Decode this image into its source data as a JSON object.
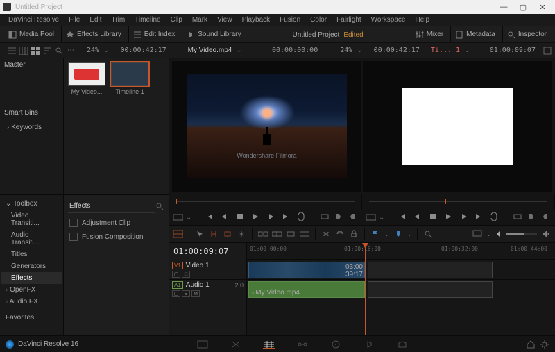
{
  "window": {
    "title": "Untitled Project"
  },
  "menu": [
    "DaVinci Resolve",
    "File",
    "Edit",
    "Trim",
    "Timeline",
    "Clip",
    "Mark",
    "View",
    "Playback",
    "Fusion",
    "Color",
    "Fairlight",
    "Workspace",
    "Help"
  ],
  "toolbar": {
    "mediaPool": "Media Pool",
    "fxLib": "Effects Library",
    "editIndex": "Edit Index",
    "soundLib": "Sound Library",
    "mixer": "Mixer",
    "metadata": "Metadata",
    "inspector": "Inspector",
    "projectTitle": "Untitled Project",
    "edited": "Edited"
  },
  "viewerbar": {
    "left": {
      "zoom": "24%",
      "tc": "00:00:42:17"
    },
    "clip": "My Video.mp4",
    "srcTc": "00:00:00:00",
    "right": {
      "zoom": "24%",
      "tc": "00:00:42:17",
      "tlname": "Ti... 1",
      "recTc": "01:00:09:07"
    }
  },
  "bins": {
    "master": "Master",
    "smartBins": "Smart Bins",
    "keywords": "Keywords"
  },
  "pool": {
    "items": [
      {
        "label": "My Video..."
      },
      {
        "label": "Timeline 1"
      }
    ]
  },
  "sidebar": {
    "toolbox": "Toolbox",
    "items": [
      "Video Transiti...",
      "Audio Transiti...",
      "Titles",
      "Generators",
      "Effects"
    ],
    "openfx": "OpenFX",
    "audiofx": "Audio FX",
    "favorites": "Favorites"
  },
  "fx": {
    "header": "Effects",
    "items": [
      "Adjustment Clip",
      "Fusion Composition"
    ]
  },
  "watermark": "Wondershare Filmora",
  "timeline": {
    "tc": "01:00:09:07",
    "ruler": [
      "01:00:00:00",
      "01:00:16:00",
      "01:00:32:00",
      "01:00:44:00"
    ],
    "tracks": [
      {
        "tag": "V1",
        "name": "Video 1",
        "btns": [
          "▢",
          "□"
        ]
      },
      {
        "tag": "A1",
        "name": "Audio 1",
        "sub": "2.0",
        "btns": [
          "▢",
          "S",
          "M"
        ]
      }
    ],
    "clipV": {
      "dur1": "03:00",
      "dur2": "39:17"
    },
    "clipA": {
      "label": "My Video.mp4"
    }
  },
  "footer": {
    "app": "DaVinci Resolve 16"
  }
}
